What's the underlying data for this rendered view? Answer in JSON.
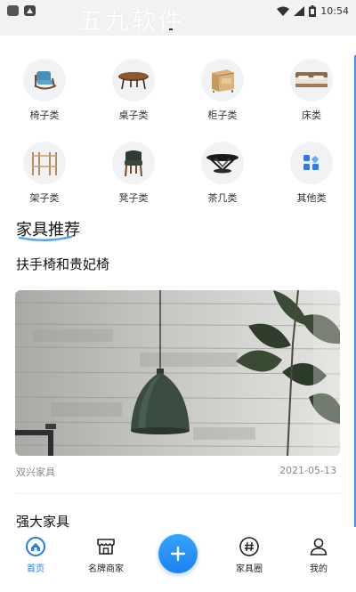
{
  "status_bar": {
    "watermark": "五九软件",
    "time": "10:54"
  },
  "categories": [
    {
      "label": "椅子类",
      "icon": "armchair-icon"
    },
    {
      "label": "桌子类",
      "icon": "table-icon"
    },
    {
      "label": "柜子类",
      "icon": "cabinet-icon"
    },
    {
      "label": "床类",
      "icon": "bed-icon"
    },
    {
      "label": "架子类",
      "icon": "shelf-icon"
    },
    {
      "label": "凳子类",
      "icon": "stool-icon"
    },
    {
      "label": "茶几类",
      "icon": "coffee-table-icon"
    },
    {
      "label": "其他类",
      "icon": "grid-blocks-icon"
    }
  ],
  "recommend": {
    "section_title": "家具推荐",
    "articles": [
      {
        "title": "扶手椅和贵妃椅",
        "source": "双兴家具",
        "date": "2021-05-13"
      },
      {
        "title": "强大家具"
      }
    ]
  },
  "bottom_nav": {
    "items": [
      {
        "label": "首页",
        "icon": "home-icon"
      },
      {
        "label": "名牌商家",
        "icon": "store-icon"
      },
      {
        "label": "",
        "icon": "plus-icon"
      },
      {
        "label": "家具圈",
        "icon": "hashtag-icon"
      },
      {
        "label": "我的",
        "icon": "profile-icon"
      }
    ]
  },
  "colors": {
    "accent": "#2a7be4",
    "fab": "#1d83f0",
    "underline": "#5aa6f0"
  }
}
